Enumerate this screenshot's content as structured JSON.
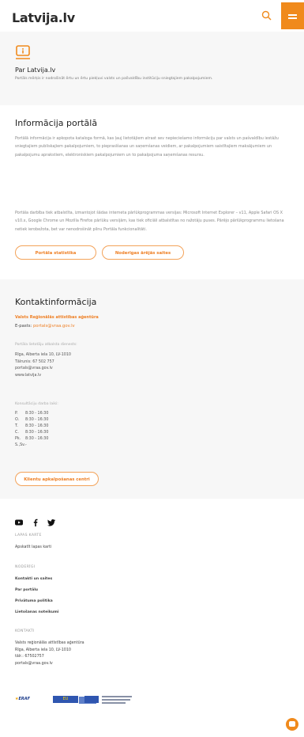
{
  "header": {
    "logo_text": "Latvija.lv",
    "search_icon": "search-icon",
    "menu_icon": "hamburger-menu-icon",
    "accent": "#f08a1c"
  },
  "about": {
    "title": "Par Latvija.lv",
    "text": "Portāls mērķis ir nodrošināt ērtu un ērtu piekļuvi valsts un pašvaldību institūciju sniegtajiem pakalpojumiem."
  },
  "info": {
    "title": "Informācija portālā",
    "paragraph1": "Portālā informācija ir apkopota kataloga formā, kas ļauj lietotājiem atrast sev nepieciešamo informāciju par valsts un pašvaldību iestāžu sniegtajiem publiskajiem pakalpojumiem, to pieprasīšanas un saņemšanas veidiem, ar pakalpojumiem saistītajiem maksājumiem un pakalpojumu aprakstiem, elektroniskiem pakalpojumiem un to pakalpojuma saņemšanas resursu.",
    "paragraph2": "Portāla darbība tiek atbalstīta, izmantojot šādas interneta pārlūkprogrammas versijas: Microsoft Internet Explorer – v11, Apple Safari OS X v10.x, Google Chrome un Mozilla Firefox pārlūku versijām, kas tiek oficiāli atbalstītas no ražotāju puses. Pārējo pārlūkprogrammu lietošana netiek ierobežota, bet var nenodrošināt pilnu Portāla funkcionalitāti.",
    "stats_button": "Portāla statistika",
    "links_button": "Noderīgas ārējās saites"
  },
  "contacts": {
    "title": "Kontaktinformācija",
    "agency": "Valsts Reģionālās attīstības aģentūra",
    "email_label": "E-pasts:",
    "email": "portals@vraa.gov.lv",
    "support_label": "Portāla lietotāju atbalsta dienests:",
    "support_lines": [
      "Rīga, Alberta iela 10, LV-1010",
      "Tālrunis: 67 502 757",
      "portals@vraa.gov.lv",
      "www.latvija.lv"
    ],
    "hours_label": "Konsultāciju darba laiki:",
    "hours": [
      {
        "day": "P.",
        "time": "8:30 - 16:30"
      },
      {
        "day": "O.",
        "time": "8:30 - 16:30"
      },
      {
        "day": "T.",
        "time": "8:30 - 16:30"
      },
      {
        "day": "C.",
        "time": "8:30 - 16:30"
      },
      {
        "day": "Pk.",
        "time": "8:30 - 16:30"
      },
      {
        "day": "S.,Sv.",
        "time": "-"
      }
    ],
    "centers_button": "Klientu apkalpošanas centri"
  },
  "footer": {
    "social": [
      "youtube-icon",
      "facebook-icon",
      "twitter-icon"
    ],
    "sitemap_label": "LAPAS KARTE",
    "sitemap_link": "Apskatīt lapas karti",
    "useful_label": "NODERĪGI",
    "useful_links": [
      "Kontakti un saites",
      "Par portālu",
      "Privātuma politika",
      "Lietošanas noteikumi"
    ],
    "contacts_label": "KONTAKTI",
    "contact_lines": [
      "Valsts reģionālās attīstības aģentūra",
      "Rīga, Alberta iela 10, LV-1010",
      "tālr.: 67502757",
      "portals@vraa.gov.lv"
    ],
    "eraf_logo": "ERAF",
    "eu_logo": "EU"
  },
  "chat_icon": "chat-bubble-icon"
}
